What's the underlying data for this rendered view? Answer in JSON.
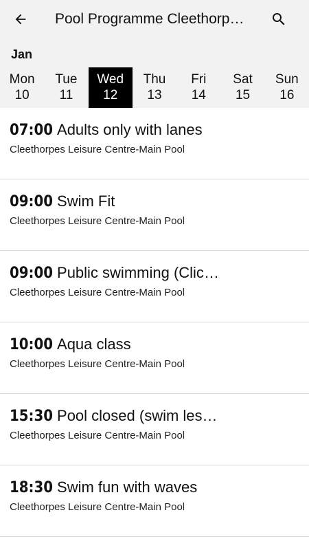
{
  "app_bar": {
    "title": "Pool Programme Cleethorpes Leisure Centre",
    "back_icon": "arrow-left-icon",
    "search_icon": "search-icon"
  },
  "week": {
    "month": "Jan",
    "selected_index": 2,
    "days": [
      {
        "name": "Mon",
        "num": "10"
      },
      {
        "name": "Tue",
        "num": "11"
      },
      {
        "name": "Wed",
        "num": "12"
      },
      {
        "name": "Thu",
        "num": "13"
      },
      {
        "name": "Fri",
        "num": "14"
      },
      {
        "name": "Sat",
        "num": "15"
      },
      {
        "name": "Sun",
        "num": "16"
      }
    ]
  },
  "sessions": [
    {
      "time": "07:00",
      "name": "Adults only with lanes",
      "venue": "Cleethorpes Leisure Centre-Main Pool"
    },
    {
      "time": "09:00",
      "name": "Swim Fit",
      "venue": "Cleethorpes Leisure Centre-Main Pool"
    },
    {
      "time": "09:00",
      "name": "Public swimming (Click here for details)",
      "venue": "Cleethorpes Leisure Centre-Main Pool"
    },
    {
      "time": "10:00",
      "name": "Aqua class",
      "venue": "Cleethorpes Leisure Centre-Main Pool"
    },
    {
      "time": "15:30",
      "name": "Pool closed (swim lessons)",
      "venue": "Cleethorpes Leisure Centre-Main Pool"
    },
    {
      "time": "18:30",
      "name": "Swim fun with waves",
      "venue": "Cleethorpes Leisure Centre-Main Pool"
    }
  ],
  "colors": {
    "header_bg": "#f2f2f2",
    "selected_bg": "#000000",
    "selected_fg": "#ffffff",
    "divider": "#d9d9d9"
  }
}
